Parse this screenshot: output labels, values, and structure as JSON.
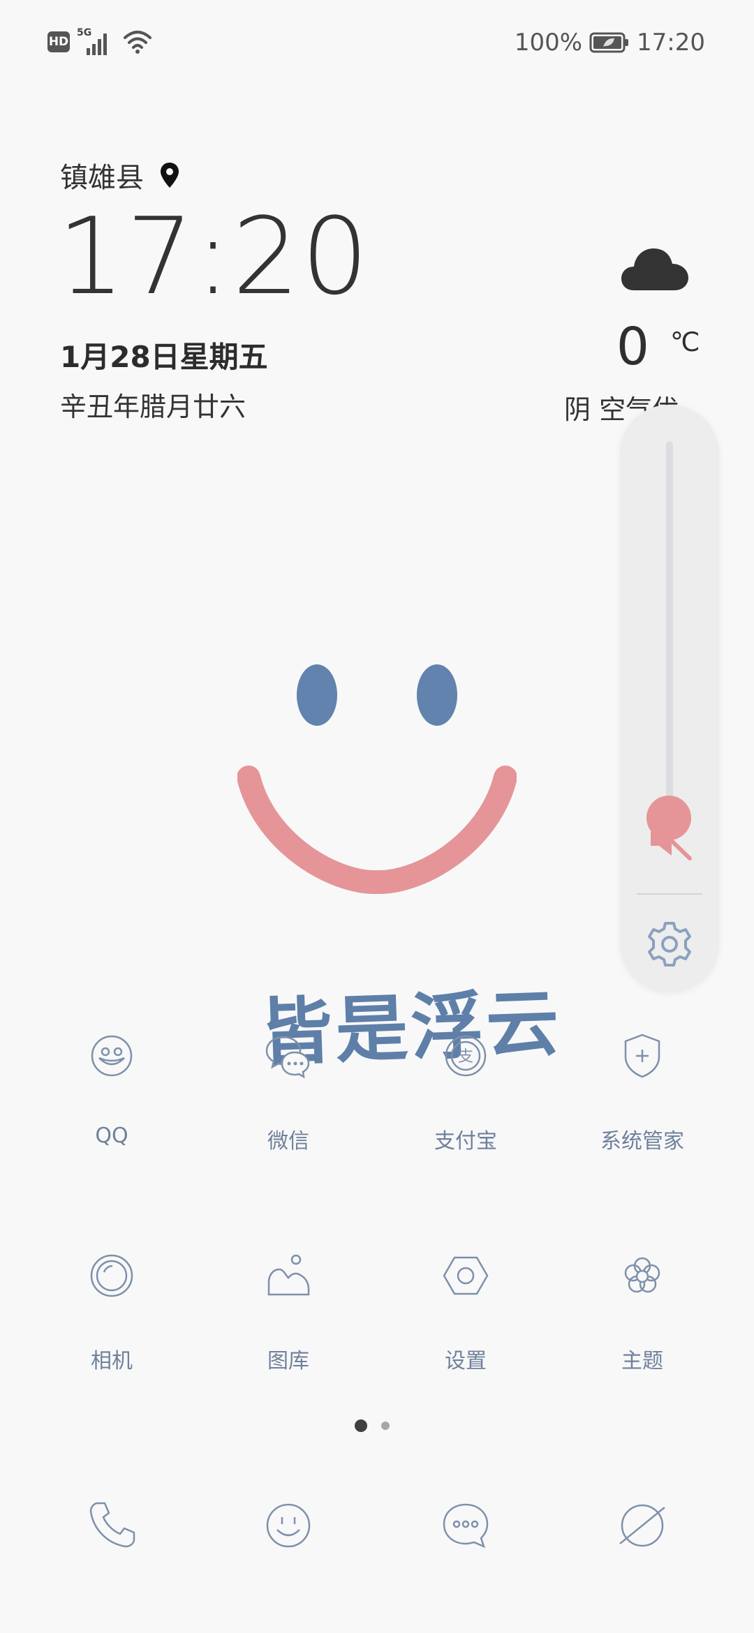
{
  "status_bar": {
    "hd_badge": "HD",
    "network_type": "5G",
    "battery_percent": "100%",
    "time": "17:20",
    "icons": [
      "signal-icon",
      "wifi-icon",
      "battery-icon"
    ]
  },
  "lockscreen": {
    "location": "镇雄县",
    "time": "17:20",
    "date": "1月28日星期五",
    "lunar_date": "辛丑年腊月廿六"
  },
  "weather": {
    "icon": "cloud-icon",
    "temperature": "0",
    "unit": "℃",
    "condition": "阴  空气优"
  },
  "volume_panel": {
    "level": 0.0,
    "muted": true,
    "icons": [
      "mute-icon",
      "settings-gear-icon"
    ]
  },
  "decoration": {
    "slogan": "皆是浮云"
  },
  "apps": [
    {
      "label": "QQ",
      "icon": "qq-icon"
    },
    {
      "label": "微信",
      "icon": "wechat-icon"
    },
    {
      "label": "支付宝",
      "icon": "alipay-icon"
    },
    {
      "label": "系统管家",
      "icon": "shield-icon"
    },
    {
      "label": "相机",
      "icon": "camera-icon"
    },
    {
      "label": "图库",
      "icon": "gallery-icon"
    },
    {
      "label": "设置",
      "icon": "settings-icon"
    },
    {
      "label": "主题",
      "icon": "theme-flower-icon"
    }
  ],
  "page_indicator": {
    "current": 1,
    "total": 2
  },
  "dock": [
    {
      "icon": "phone-icon"
    },
    {
      "icon": "contacts-smile-icon"
    },
    {
      "icon": "messages-icon"
    },
    {
      "icon": "browser-icon"
    }
  ],
  "colors": {
    "accent_blue": "#6183ad",
    "accent_pink": "#e59597",
    "icon_stroke": "#7e90a9"
  }
}
